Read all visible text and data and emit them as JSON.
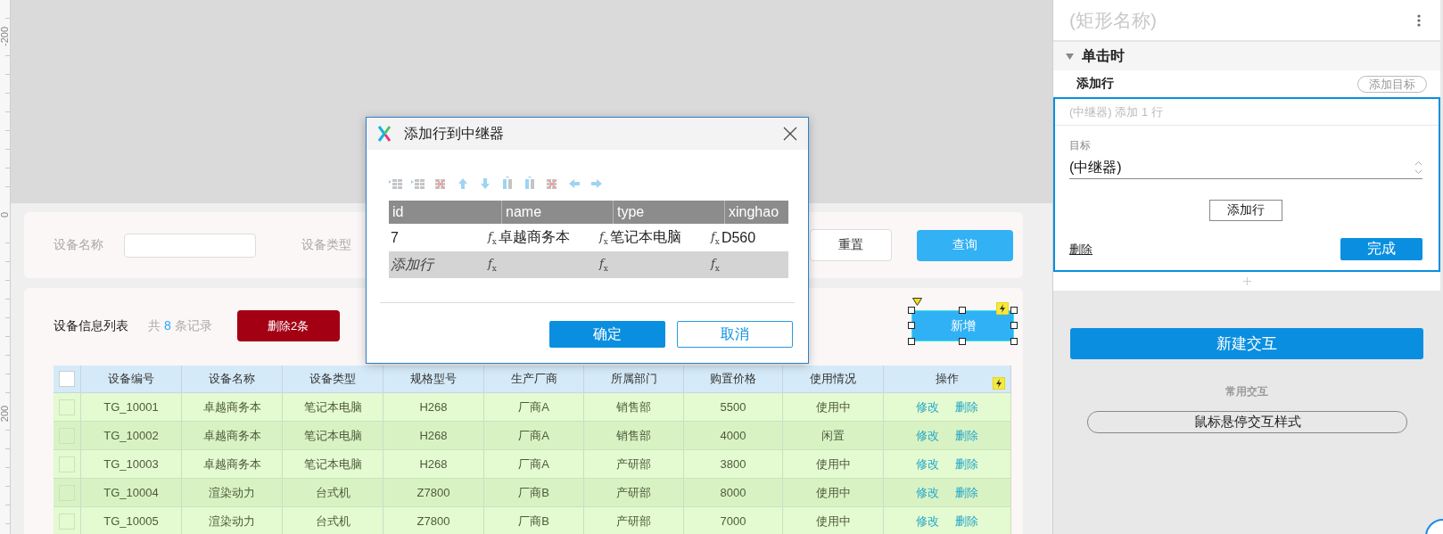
{
  "ruler": {
    "labels": [
      "-200",
      "0",
      "200"
    ]
  },
  "search_form": {
    "name_label": "设备名称",
    "type_label": "设备类型",
    "buttons": [
      {
        "label": "重置",
        "kind": "secondary"
      },
      {
        "label": "查询",
        "kind": "primary"
      }
    ]
  },
  "device_list": {
    "title": "设备信息列表",
    "count_prefix": "共",
    "count": "8",
    "count_suffix": "条记录",
    "delete_button": "删除2条",
    "add_button": {
      "label": "新增",
      "selected": true
    },
    "table": {
      "select_all_checked": false,
      "columns": [
        "设备编号",
        "设备名称",
        "设备类型",
        "规格型号",
        "生产厂商",
        "所属部门",
        "购置价格",
        "使用情况",
        "操作"
      ],
      "rows": [
        {
          "checked": false,
          "cells": [
            "TG_10001",
            "卓越商务本",
            "笔记本电脑",
            "H268",
            "厂商A",
            "销售部",
            "5500",
            "使用中"
          ],
          "actions": [
            "修改",
            "删除"
          ]
        },
        {
          "checked": false,
          "cells": [
            "TG_10002",
            "卓越商务本",
            "笔记本电脑",
            "H268",
            "厂商A",
            "销售部",
            "4000",
            "闲置"
          ],
          "actions": [
            "修改",
            "删除"
          ]
        },
        {
          "checked": false,
          "cells": [
            "TG_10003",
            "卓越商务本",
            "笔记本电脑",
            "H268",
            "厂商A",
            "产研部",
            "3800",
            "使用中"
          ],
          "actions": [
            "修改",
            "删除"
          ]
        },
        {
          "checked": false,
          "cells": [
            "TG_10004",
            "渲染动力",
            "台式机",
            "Z7800",
            "厂商B",
            "产研部",
            "8000",
            "使用中"
          ],
          "actions": [
            "修改",
            "删除"
          ]
        },
        {
          "checked": false,
          "cells": [
            "TG_10005",
            "渲染动力",
            "台式机",
            "Z7800",
            "厂商B",
            "产研部",
            "7000",
            "使用中"
          ],
          "actions": [
            "修改",
            "删除"
          ]
        }
      ]
    }
  },
  "dialog": {
    "title": "添加行到中继器",
    "table": {
      "columns": [
        "id",
        "name",
        "type",
        "xinghao"
      ],
      "rows": [
        {
          "kind": "data",
          "cells": [
            {
              "text": "7"
            },
            {
              "formula": "*f*$_{x}$",
              "text": "卓越商务本"
            },
            {
              "formula": "*f*$_{x}$",
              "text": "笔记本电脑"
            },
            {
              "formula": "*f*$_{x}$",
              "text": "D560"
            }
          ]
        },
        {
          "kind": "new_row",
          "cells": [
            {
              "text": "添加行"
            },
            {
              "formula": "*f*$_{x}$"
            },
            {
              "formula": "*f*$_{x}$"
            },
            {
              "formula": "*f*$_{x}$"
            }
          ]
        }
      ]
    },
    "buttons": [
      {
        "label": "确定",
        "kind": "primary"
      },
      {
        "label": "取消",
        "kind": "secondary"
      }
    ]
  },
  "panel": {
    "name_field": {
      "placeholder": "(矩形名称)"
    },
    "event": {
      "label": "单击时",
      "expanded": true
    },
    "action": {
      "label": "添加行",
      "add_target": "添加目标"
    },
    "action_editor": {
      "summary": "(中继器) 添加 1 行",
      "target_label": "目标",
      "target_value": "(中继器)",
      "add_row_button": "添加行",
      "delete_link": "删除",
      "done_button": "完成"
    },
    "new_interaction_button": "新建交互",
    "common_title": "常用交互",
    "common_items": [
      "鼠标悬停交互样式"
    ]
  }
}
